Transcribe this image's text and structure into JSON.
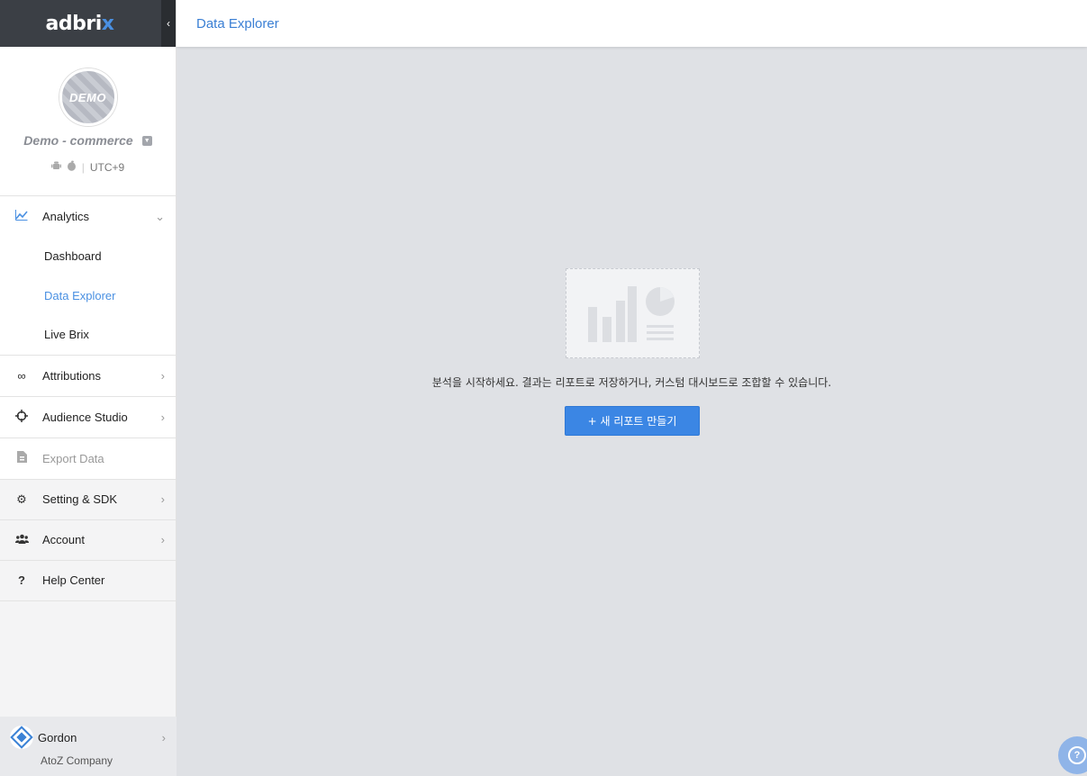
{
  "logo": {
    "text_main": "adbri",
    "text_accent": "x"
  },
  "sidebar": {
    "collapse_icon": "‹",
    "profile": {
      "avatar_text": "DEMO",
      "project_name": "Demo - commerce",
      "timezone": "UTC+9"
    },
    "analytics": {
      "label": "Analytics",
      "items": [
        {
          "label": "Dashboard"
        },
        {
          "label": "Data Explorer"
        },
        {
          "label": "Live Brix"
        }
      ]
    },
    "menu": [
      {
        "label": "Attributions"
      },
      {
        "label": "Audience Studio"
      },
      {
        "label": "Export Data"
      }
    ],
    "lower_menu": [
      {
        "label": "Setting & SDK"
      },
      {
        "label": "Account"
      },
      {
        "label": "Help Center"
      }
    ],
    "user": {
      "name": "Gordon",
      "company": "AtoZ Company"
    }
  },
  "header": {
    "title": "Data Explorer"
  },
  "empty_state": {
    "message": "분석을 시작하세요. 결과는 리포트로 저장하거나, 커스텀 대시보드로 조합할 수 있습니다.",
    "button_label": "+ 새 리포트 만들기"
  },
  "colors": {
    "accent": "#4a90e2",
    "button": "#3b86e4",
    "topbar": "#3b3f45"
  }
}
